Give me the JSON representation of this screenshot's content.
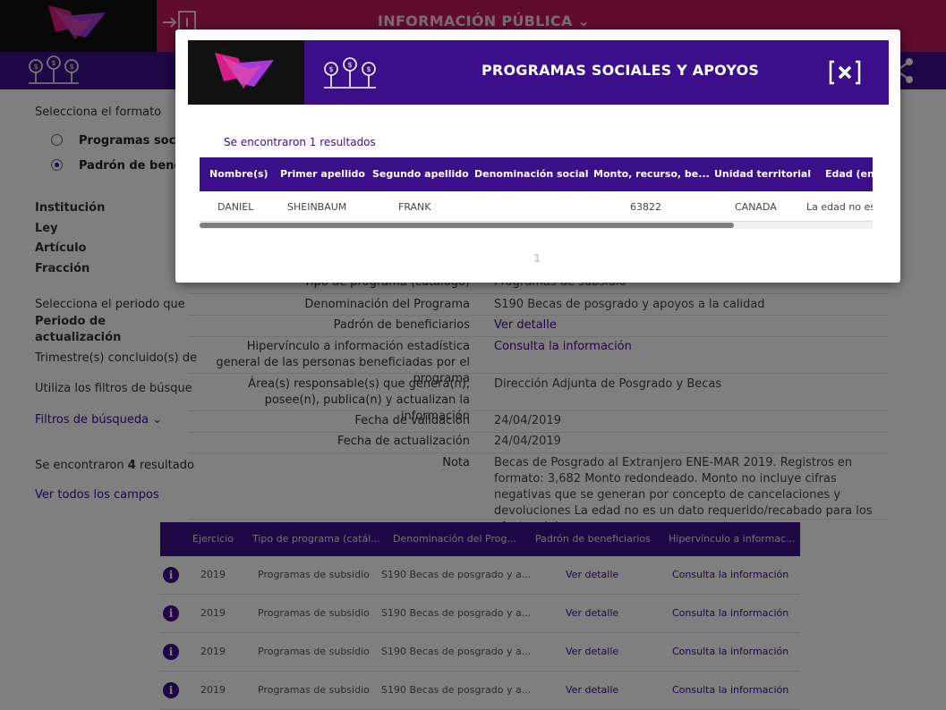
{
  "header": {
    "title": "INFORMACIÓN PÚBLICA",
    "dropdown_icon": "chevron-down-icon",
    "exit_icon": "login-icon",
    "share_icon": "share-icon",
    "program_icon": "money-tree-icon"
  },
  "left": {
    "select_format": "Selecciona el formato",
    "format_options": [
      "Programas sociales",
      "Padrón de beneficiarios"
    ],
    "selected_option": "Padrón de beneficiarios",
    "field_labels": [
      "Institución",
      "Ley",
      "Artículo",
      "Fracción"
    ],
    "period_prompt": "Selecciona el periodo que",
    "period_label": "Periodo de actualización",
    "quarter_label": "Trimestre(s) concluido(s) de",
    "filters_hint": "Utiliza los filtros de búsque",
    "filters_toggle": "Filtros de búsqueda",
    "results_prefix": "Se encontraron",
    "results_count": "4",
    "results_suffix": "resultado",
    "view_all": "Ver todos los campos"
  },
  "detail": {
    "rows": [
      {
        "label": "Tipo de programa (catálogo)",
        "value": "Programas de subsidio",
        "link": false
      },
      {
        "label": "Denominación del Programa",
        "value": "S190 Becas de posgrado y apoyos a la calidad",
        "link": false
      },
      {
        "label": "Padrón de beneficiarios",
        "value": "Ver detalle",
        "link": true
      },
      {
        "label": "Hipervínculo a información estadística general de las personas beneficiadas por el programa",
        "value": "Consulta la información",
        "link": true
      },
      {
        "label": "Área(s) responsable(s) que genera(n), posee(n), publica(n) y actualizan la información",
        "value": "Dirección Adjunta de Posgrado y Becas",
        "link": false
      },
      {
        "label": "Fecha de validación",
        "value": "24/04/2019",
        "link": false
      },
      {
        "label": "Fecha de actualización",
        "value": "24/04/2019",
        "link": false
      },
      {
        "label": "Nota",
        "value": "Becas de Posgrado al Extranjero ENE-MAR 2019. Registros en formato: 3,682 Monto redondeado. Monto no incluye cifras negativas que se generan por concepto de cancelaciones y devoluciones La edad no es un dato requerido/recabado para los efectos del programa",
        "link": false
      }
    ]
  },
  "results": {
    "columns": [
      "Ejercicio",
      "Tipo de programa (catál...",
      "Denominación del Prog...",
      "Padrón de beneficiarios",
      "Hipervínculo a informac..."
    ],
    "rows": [
      [
        "2019",
        "Programas de subsidio",
        "S190 Becas de posgrado y a...",
        "Ver detalle",
        "Consulta la información"
      ],
      [
        "2019",
        "Programas de subsidio",
        "S190 Becas de posgrado y a...",
        "Ver detalle",
        "Consulta la información"
      ],
      [
        "2019",
        "Programas de subsidio",
        "S190 Becas de posgrado y a...",
        "Ver detalle",
        "Consulta la información"
      ],
      [
        "2019",
        "Programas de subsidio",
        "S190 Becas de posgrado y a...",
        "Ver detalle",
        "Consulta la información"
      ]
    ],
    "row_icon": "info-icon"
  },
  "modal": {
    "title": "PROGRAMAS SOCIALES Y APOYOS",
    "close_icon": "close-icon",
    "count_prefix": "Se encontraron",
    "count": "1",
    "count_suffix": "resultados",
    "columns": [
      "Nombre(s)",
      "Primer apellido",
      "Segundo apellido",
      "Denominación social",
      "Monto, recurso, be...",
      "Unidad territorial",
      "Edad (en s"
    ],
    "row": [
      "DANIEL",
      "SHEINBAUM",
      "FRANK",
      "",
      "63822",
      "CANADA",
      "La edad no es"
    ],
    "page": "1"
  },
  "colors": {
    "brand_purple": "#3b0f8a",
    "brand_magenta": "#c2175b"
  }
}
